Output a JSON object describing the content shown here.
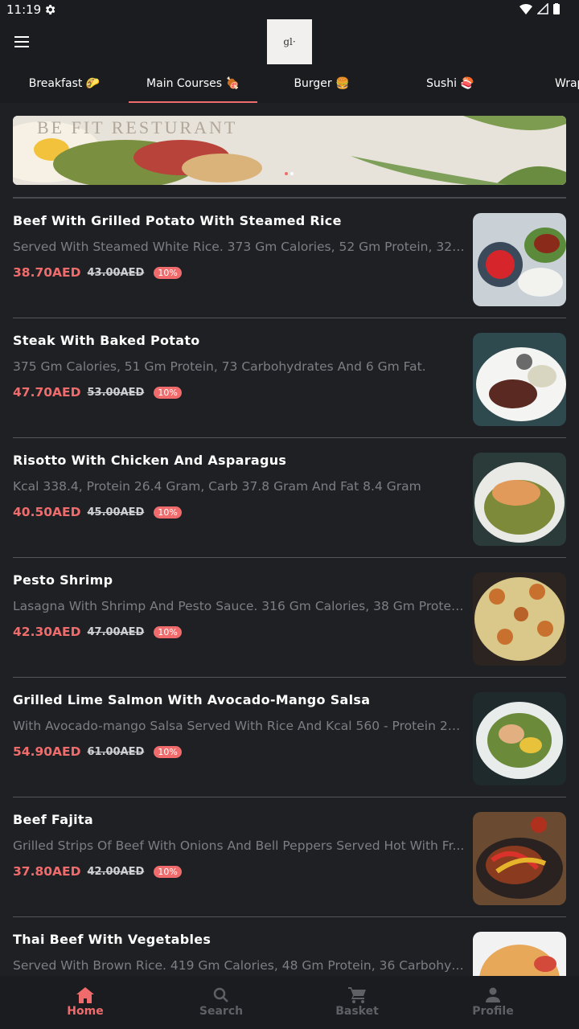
{
  "status": {
    "time": "11:19"
  },
  "logo_text": "gl·",
  "tabs": [
    {
      "label": "Breakfast 🌮"
    },
    {
      "label": "Main Courses 🍖"
    },
    {
      "label": "Burger 🍔"
    },
    {
      "label": "Sushi 🍣"
    },
    {
      "label": "Wrap"
    }
  ],
  "banner": {
    "title": "BE FIT RESTURANT"
  },
  "items": [
    {
      "name": "Beef With Grilled Potato With Steamed Rice",
      "desc": "Served With Steamed White Rice. 373 Gm Calories, 52 Gm Protein, 32 C...",
      "price": "38.70AED",
      "old_price": "43.00AED",
      "discount": "10%"
    },
    {
      "name": "Steak With Baked Potato",
      "desc": "375 Gm Calories, 51 Gm Protein, 73 Carbohydrates And 6 Gm Fat.",
      "price": "47.70AED",
      "old_price": "53.00AED",
      "discount": "10%"
    },
    {
      "name": "Risotto With Chicken And Asparagus",
      "desc": "Kcal 338.4, Protein 26.4 Gram, Carb 37.8 Gram And Fat 8.4 Gram",
      "price": "40.50AED",
      "old_price": "45.00AED",
      "discount": "10%"
    },
    {
      "name": "Pesto Shrimp",
      "desc": "Lasagna With Shrimp And Pesto Sauce. 316 Gm Calories, 38 Gm Protein...",
      "price": "42.30AED",
      "old_price": "47.00AED",
      "discount": "10%"
    },
    {
      "name": "Grilled Lime Salmon With Avocado-Mango Salsa",
      "desc": "With Avocado-mango Salsa Served With Rice And Kcal 560 - Protein 23 ...",
      "price": "54.90AED",
      "old_price": "61.00AED",
      "discount": "10%"
    },
    {
      "name": "Beef Fajita",
      "desc": "Grilled Strips Of Beef With Onions And Bell Peppers Served Hot With Fr...",
      "price": "37.80AED",
      "old_price": "42.00AED",
      "discount": "10%"
    },
    {
      "name": "Thai Beef With Vegetables",
      "desc": "Served With Brown Rice. 419 Gm Calories, 48 Gm Protein, 36 Carbohydr...",
      "price": "",
      "old_price": "",
      "discount": ""
    }
  ],
  "nav": [
    {
      "label": "Home",
      "icon": "home-icon"
    },
    {
      "label": "Search",
      "icon": "search-icon"
    },
    {
      "label": "Basket",
      "icon": "cart-icon"
    },
    {
      "label": "Profile",
      "icon": "person-icon"
    }
  ],
  "colors": {
    "accent": "#f06c6c",
    "background": "#1f2024",
    "bar": "#1b1c20"
  }
}
